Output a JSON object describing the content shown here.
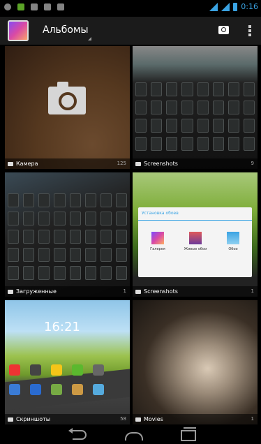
{
  "status_bar": {
    "time": "0:16",
    "accent_color": "#3aa3e3"
  },
  "action_bar": {
    "title": "Альбомы",
    "camera_button_icon": "camera-icon",
    "overflow_icon": "overflow-menu-icon"
  },
  "albums": [
    {
      "name": "Камера",
      "count": "125",
      "icon": "camera-icon"
    },
    {
      "name": "Screenshots",
      "count": "9",
      "icon": "folder-icon"
    },
    {
      "name": "Загруженные",
      "count": "1",
      "icon": "folder-icon"
    },
    {
      "name": "Screenshots",
      "count": "1",
      "icon": "folder-icon"
    },
    {
      "name": "Скриншоты",
      "count": "58",
      "icon": "folder-icon"
    },
    {
      "name": "Movies",
      "count": "1",
      "icon": "folder-icon"
    }
  ],
  "wallpaper_dialog": {
    "title": "Установка обоев",
    "options": [
      "Галерея",
      "Живые обои",
      "Обои"
    ]
  },
  "screenshot_clock": "16:21",
  "nav_bar": {
    "back_icon": "back-icon",
    "home_icon": "home-icon",
    "recent_icon": "recent-apps-icon"
  }
}
